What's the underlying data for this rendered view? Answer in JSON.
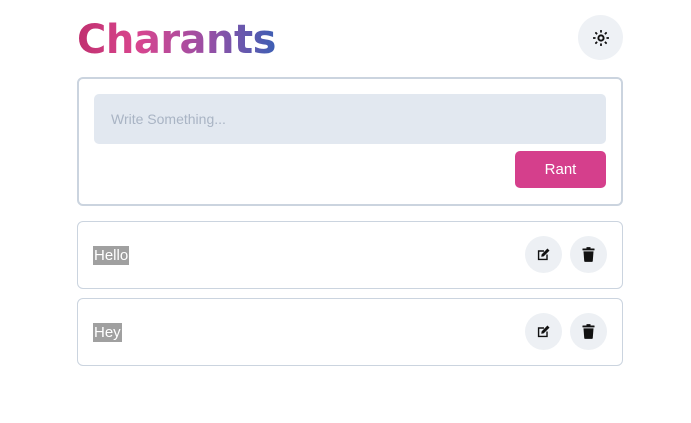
{
  "app": {
    "title": "Charants",
    "theme_toggle_icon": "sun-icon"
  },
  "composer": {
    "placeholder": "Write Something...",
    "value": "",
    "submit_label": "Rant"
  },
  "posts": [
    {
      "text": "Hello",
      "edit_icon": "edit-icon",
      "delete_icon": "trash-icon"
    },
    {
      "text": "Hey",
      "edit_icon": "edit-icon",
      "delete_icon": "trash-icon"
    }
  ],
  "colors": {
    "accent": "#d53f8c",
    "input_bg": "#e2e8f0",
    "border": "#cbd4df",
    "icon_button_bg": "#edf0f4"
  }
}
